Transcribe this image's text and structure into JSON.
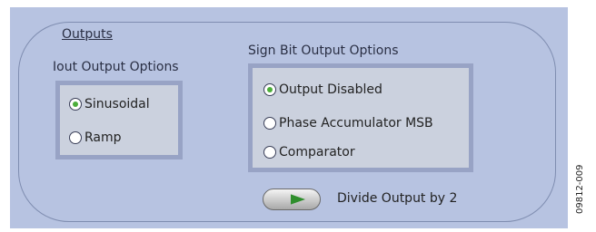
{
  "panel": {
    "title": "Outputs"
  },
  "iout": {
    "label": "Iout Output Options",
    "options": [
      "Sinusoidal",
      "Ramp"
    ],
    "selected": "Sinusoidal"
  },
  "sign_bit": {
    "label": "Sign Bit Output Options",
    "options": [
      "Output Disabled",
      "Phase Accumulator MSB",
      "Comparator"
    ],
    "selected": "Output Disabled"
  },
  "divide": {
    "label": "Divide Output by 2",
    "icon": "play-arrow-icon",
    "state": "off"
  },
  "figure_id": "09812-009",
  "colors": {
    "panel_bg": "#b7c3e1",
    "group_bg": "#cbd1de",
    "group_border": "#98a3c5",
    "radio_selected": "#4cae3a",
    "toggle_arrow": "#2f8e2c"
  }
}
